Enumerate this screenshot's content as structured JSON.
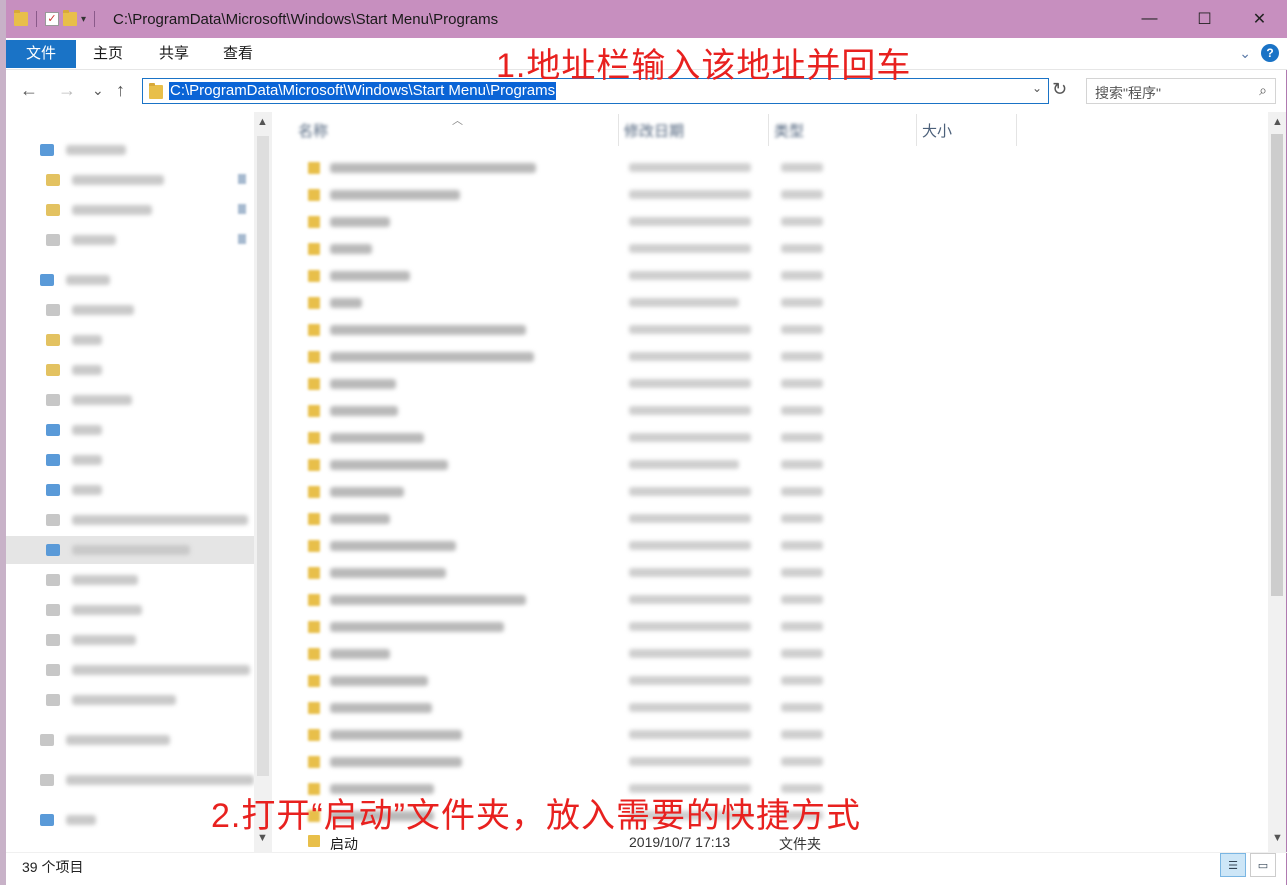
{
  "window": {
    "title": "C:\\ProgramData\\Microsoft\\Windows\\Start Menu\\Programs",
    "minimize": "—",
    "maximize": "☐",
    "close": "✕"
  },
  "ribbon": {
    "tabs": [
      "文件",
      "主页",
      "共享",
      "查看"
    ]
  },
  "annotations": {
    "step1": "1.地址栏输入该地址并回车",
    "step2": "2.打开“启动”文件夹，放入需要的快捷方式"
  },
  "address_bar": {
    "path": "C:\\ProgramData\\Microsoft\\Windows\\Start Menu\\Programs",
    "search_placeholder": "搜索\"程序\""
  },
  "columns": {
    "name": "名称",
    "modified": "修改日期",
    "type": "类型",
    "size": "大小"
  },
  "visible_item": {
    "name": "启动",
    "modified": "2019/10/7 17:13",
    "type": "文件夹"
  },
  "status": {
    "item_count": "39 个项目"
  },
  "colors": {
    "title_bar": "#c78fbf",
    "accent": "#1a73c6",
    "selection": "#0a64d6",
    "annotation": "#e8211f",
    "folder": "#e8bf4a"
  },
  "icons": {
    "back": "←",
    "forward": "→",
    "recent": "⌄",
    "up": "↑",
    "refresh": "↻",
    "search": "⌕",
    "dropdown": "⌄",
    "scroll_up": "▲",
    "scroll_down": "▼"
  }
}
